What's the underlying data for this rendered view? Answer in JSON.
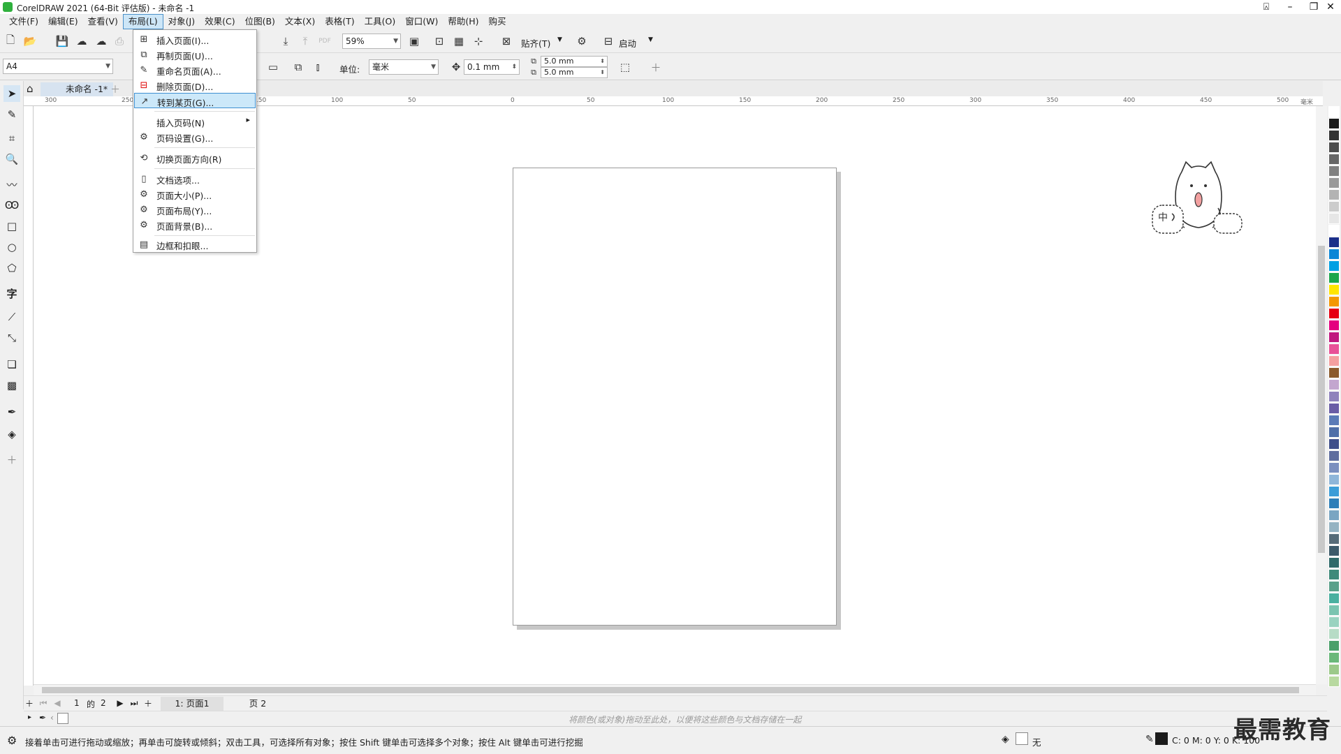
{
  "window": {
    "title": "CorelDRAW 2021 (64-Bit 评估版) - 未命名 -1"
  },
  "menubar": [
    "文件(F)",
    "编辑(E)",
    "查看(V)",
    "布局(L)",
    "对象(J)",
    "效果(C)",
    "位图(B)",
    "文本(X)",
    "表格(T)",
    "工具(O)",
    "窗口(W)",
    "帮助(H)",
    "购买"
  ],
  "active_menu_index": 3,
  "layout_menu": {
    "items": [
      {
        "label": "插入页面(I)...",
        "icon": "insert-page-icon"
      },
      {
        "label": "再制页面(U)...",
        "icon": "duplicate-page-icon"
      },
      {
        "label": "重命名页面(A)...",
        "icon": "rename-page-icon"
      },
      {
        "label": "删除页面(D)...",
        "icon": "delete-page-icon"
      },
      {
        "label": "转到某页(G)...",
        "icon": "go-to-page-icon"
      },
      {
        "label": "插入页码(N)",
        "icon": "",
        "submenu": "▸"
      },
      {
        "label": "页码设置(G)...",
        "icon": "page-number-settings-icon"
      },
      {
        "label": "切换页面方向(R)",
        "icon": "switch-orientation-icon"
      },
      {
        "label": "文档选项...",
        "icon": "document-options-icon"
      },
      {
        "label": "页面大小(P)...",
        "icon": "page-size-icon"
      },
      {
        "label": "页面布局(Y)...",
        "icon": "page-layout-icon"
      },
      {
        "label": "页面背景(B)...",
        "icon": "page-background-icon"
      },
      {
        "label": "边框和扣眼...",
        "icon": "borders-grommets-icon"
      }
    ],
    "highlighted_index": 4
  },
  "toolbar1": {
    "zoom": "59%",
    "snap_label": "贴齐(T)",
    "launch_label": "启动"
  },
  "toolbar2": {
    "page_size": "A4",
    "unit_label": "单位:",
    "unit_value": "毫米",
    "nudge": "0.1 mm",
    "dup_x": "5.0 mm",
    "dup_y": "5.0 mm"
  },
  "document_tab": "未命名 -1*",
  "ruler_ticks": [
    "300",
    "250",
    "150",
    "100",
    "50",
    "0",
    "50",
    "100",
    "150",
    "200",
    "250",
    "300",
    "350",
    "400",
    "450",
    "500"
  ],
  "ruler_unit": "毫米",
  "page_nav": {
    "current": "1",
    "of": "的",
    "total": "2",
    "tabs": [
      "1: 页面1",
      "页 2"
    ]
  },
  "color_hint": "将颜色(或对象)拖动至此处，以便将这些颜色与文档存储在一起",
  "status": {
    "message": "接着单击可进行拖动或缩放；再单击可旋转或倾斜；双击工具，可选择所有对象；按住 Shift 键单击可选择多个对象；按住 Alt 键单击可进行挖掘",
    "fill_label": "无",
    "cmyk": "C: 0 M: 0 Y: 0 K: 100"
  },
  "mascot_text": "中",
  "watermark": "最需教育",
  "palette_colors": [
    "#ffffff",
    "#1a1a1a",
    "#333333",
    "#4d4d4d",
    "#666666",
    "#808080",
    "#999999",
    "#b3b3b3",
    "#cccccc",
    "#e6e6e6",
    "#ffffff",
    "#1b2f8a",
    "#0b86d6",
    "#00a0e3",
    "#1aa64a",
    "#ffe500",
    "#f39800",
    "#e60012",
    "#e4007f",
    "#c0177f",
    "#e85298",
    "#f4a0a0",
    "#8b5a2b",
    "#c3a6cf",
    "#8f82bc",
    "#6a5da6",
    "#5b7bb7",
    "#4f6fa8",
    "#3e4e8a",
    "#5f6d9e",
    "#7b8fbf",
    "#8fb6d9",
    "#3c9dd8",
    "#2f7fb8",
    "#7aa5c2",
    "#95b3c2",
    "#566b78",
    "#3c5a6a",
    "#2f6a6a",
    "#3f8a7a",
    "#5aa08a",
    "#4ab0a0",
    "#7bc4b0",
    "#9ad3c0",
    "#b7dcc6",
    "#4aa06a",
    "#6ab87a",
    "#9cc98a",
    "#b8d9a0"
  ]
}
